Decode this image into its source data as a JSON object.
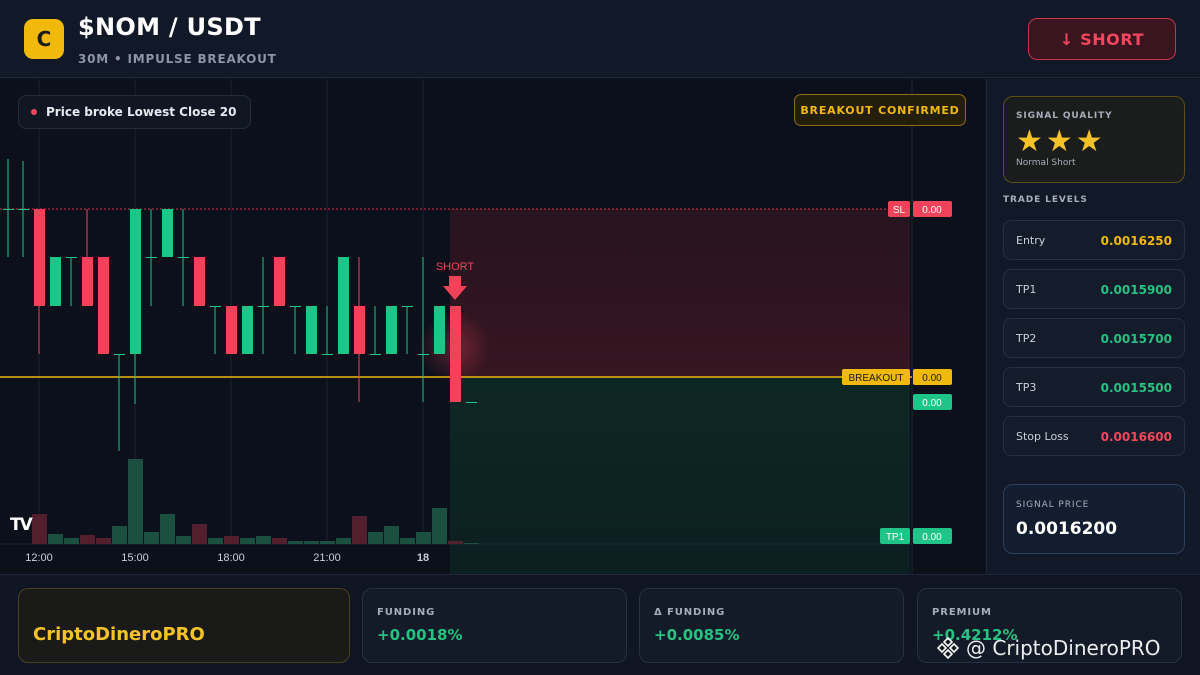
{
  "header": {
    "logo_letter": "C",
    "pair": "$NOM / USDT",
    "subtitle": "30M • IMPULSE BREAKOUT",
    "action_label": "↓ SHORT",
    "colors": {
      "accent": "#f0b90b",
      "short": "#f6465d"
    }
  },
  "chart": {
    "pill_text": "Price broke Lowest Close 20",
    "confirmed_badge": "BREAKOUT CONFIRMED",
    "time_labels": [
      "12:00",
      "15:00",
      "18:00",
      "21:00",
      "18"
    ],
    "short_marker": "SHORT",
    "tags": {
      "sl_name": "SL",
      "sl_value": "0.00",
      "breakout_name": "BREAKOUT",
      "breakout_value": "0.00",
      "last_value": "0.00",
      "tp1_name": "TP1",
      "tp1_value": "0.00"
    },
    "tv_logo": "TV",
    "colors": {
      "up": "#1fc488",
      "down": "#f0435a",
      "breakout": "#f0b90b"
    }
  },
  "side": {
    "quality_label": "SIGNAL QUALITY",
    "stars": "★★★",
    "quality_sub": "Normal Short",
    "levels_title": "TRADE LEVELS",
    "levels": [
      {
        "name": "Entry",
        "value": "0.0016250",
        "color": "#f0b90b"
      },
      {
        "name": "TP1",
        "value": "0.0015900",
        "color": "#26c281"
      },
      {
        "name": "TP2",
        "value": "0.0015700",
        "color": "#26c281"
      },
      {
        "name": "TP3",
        "value": "0.0015500",
        "color": "#26c281"
      },
      {
        "name": "Stop Loss",
        "value": "0.0016600",
        "color": "#f6465d"
      }
    ],
    "signal_price_label": "SIGNAL PRICE",
    "signal_price": "0.0016200"
  },
  "footer": {
    "brand": "CriptoDineroPRO",
    "metrics": [
      {
        "label": "FUNDING",
        "value": "+0.0018%"
      },
      {
        "label": "Δ FUNDING",
        "value": "+0.0085%"
      },
      {
        "label": "PREMIUM",
        "value": "+0.4212%"
      }
    ],
    "watermark": "@ CriptoDineroPRO"
  }
}
